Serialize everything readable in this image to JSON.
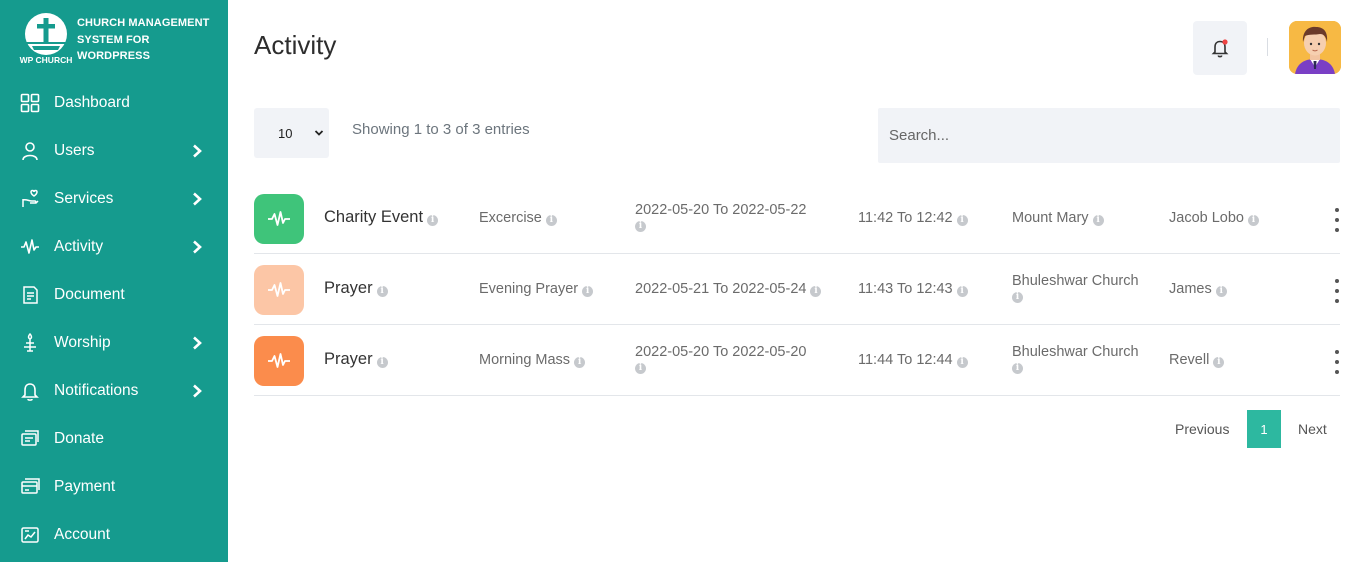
{
  "brand": {
    "logo_text": "WP CHURCH",
    "title": "CHURCH MANAGEMENT SYSTEM FOR WORDPRESS"
  },
  "sidebar": {
    "items": [
      {
        "label": "Dashboard",
        "icon": "grid-icon",
        "has_submenu": false
      },
      {
        "label": "Users",
        "icon": "user-icon",
        "has_submenu": true
      },
      {
        "label": "Services",
        "icon": "hand-heart-icon",
        "has_submenu": true
      },
      {
        "label": "Activity",
        "icon": "pulse-icon",
        "has_submenu": true
      },
      {
        "label": "Document",
        "icon": "document-icon",
        "has_submenu": false
      },
      {
        "label": "Worship",
        "icon": "candle-icon",
        "has_submenu": true
      },
      {
        "label": "Notifications",
        "icon": "bell-icon",
        "has_submenu": true
      },
      {
        "label": "Donate",
        "icon": "donate-icon",
        "has_submenu": false
      },
      {
        "label": "Payment",
        "icon": "payment-icon",
        "has_submenu": false
      },
      {
        "label": "Account",
        "icon": "account-icon",
        "has_submenu": false
      }
    ]
  },
  "header": {
    "title": "Activity",
    "notification_dot_color": "#ef4444"
  },
  "table_controls": {
    "page_length": "10",
    "showing_text": "Showing 1 to 3 of 3 entries",
    "search_placeholder": "Search..."
  },
  "rows": [
    {
      "name": "Charity Event",
      "type": "Excercise",
      "dates": "2022-05-20 To 2022-05-22",
      "time": "11:42 To 12:42",
      "venue": "Mount Mary",
      "person": "Jacob Lobo",
      "tile_color": "#3fc47a"
    },
    {
      "name": "Prayer",
      "type": "Evening Prayer",
      "dates": "2022-05-21 To 2022-05-24",
      "time": "11:43 To 12:43",
      "venue": "Bhuleshwar Church",
      "person": "James",
      "tile_color": "#fcc6a6"
    },
    {
      "name": "Prayer",
      "type": "Morning Mass",
      "dates": "2022-05-20 To 2022-05-20",
      "time": "11:44 To 12:44",
      "venue": "Bhuleshwar Church",
      "person": "Revell",
      "tile_color": "#fb8c4c"
    }
  ],
  "pagination": {
    "previous": "Previous",
    "current": "1",
    "next": "Next"
  },
  "colors": {
    "sidebar": "#159b8e",
    "accent": "#2db8a0"
  }
}
